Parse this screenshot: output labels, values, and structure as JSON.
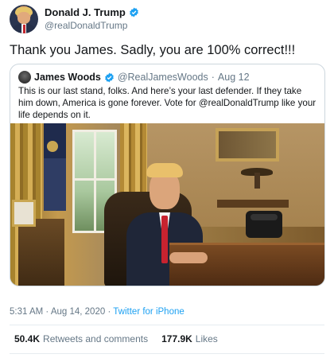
{
  "author": {
    "display_name": "Donald J. Trump",
    "handle": "@realDonaldTrump",
    "verified": true
  },
  "tweet": {
    "text": "Thank you James. Sadly, you are 100% correct!!!"
  },
  "quoted_tweet": {
    "display_name": "James Woods",
    "handle": "@RealJamesWoods",
    "separator": "·",
    "date": "Aug 12",
    "verified": true,
    "text": "This is our last stand, folks. And here’s your last defender. If they take him down, America is gone forever. Vote for @realDonaldTrump like your life depends on it."
  },
  "meta": {
    "time": "5:31 AM",
    "separator": "·",
    "date": "Aug 14, 2020",
    "source": "Twitter for iPhone"
  },
  "stats": {
    "retweets_count": "50.4K",
    "retweets_label": "Retweets and comments",
    "likes_count": "177.9K",
    "likes_label": "Likes"
  },
  "colors": {
    "verified": "#1da1f2",
    "link": "#1da1f2",
    "secondary_text": "#657786"
  },
  "icons": [
    "verified-badge-icon"
  ]
}
